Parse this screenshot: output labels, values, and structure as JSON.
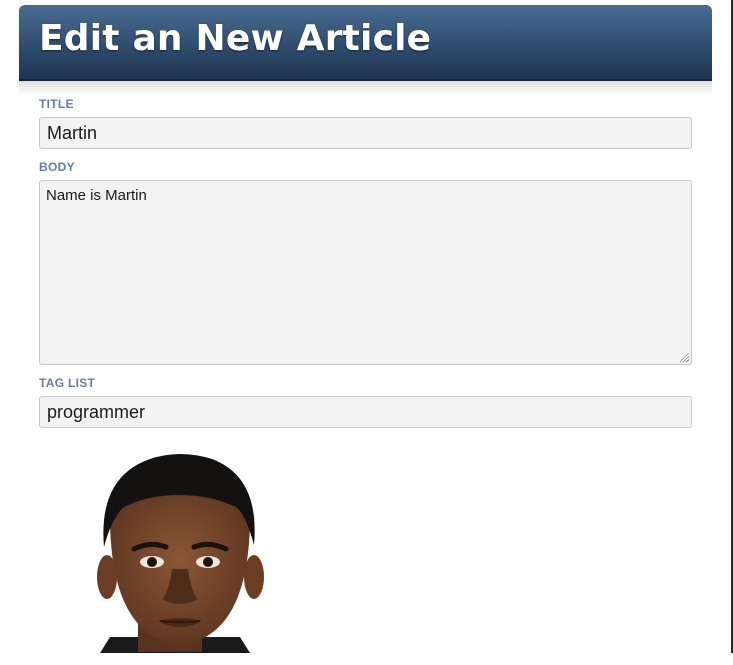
{
  "header": {
    "title": "Edit an New Article"
  },
  "form": {
    "title": {
      "label": "TITLE",
      "value": "Martin"
    },
    "body": {
      "label": "BODY",
      "value": "Name is Martin"
    },
    "tag_list": {
      "label": "TAG LIST",
      "value": "programmer"
    }
  },
  "photo": {
    "kind": "portrait-photo",
    "subject": "person"
  },
  "colors": {
    "header_top": "#4a6c93",
    "header_bottom": "#1f3550",
    "label": "#6a7f9b",
    "field_bg": "#f3f3f3",
    "field_border": "#c9c9c9"
  }
}
